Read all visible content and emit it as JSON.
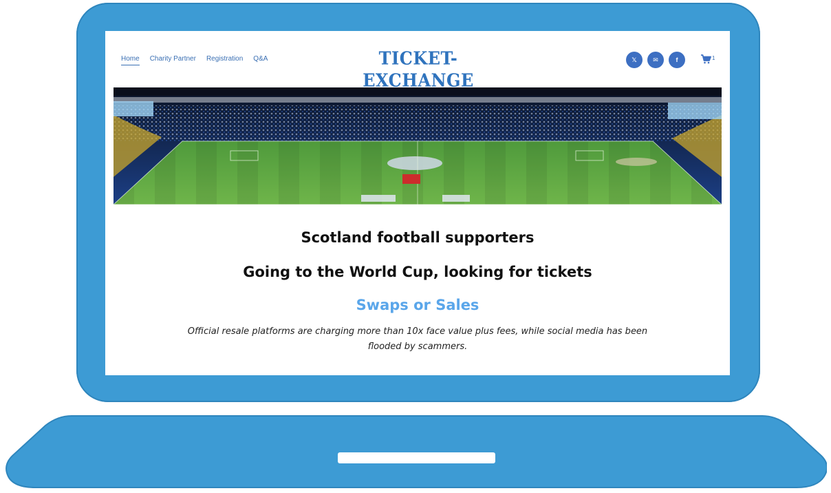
{
  "colors": {
    "frame": "#3d9bd4",
    "accent": "#2f73bd",
    "swaps": "#5aa6ea",
    "social": "#3d6fc2"
  },
  "nav": {
    "items": [
      {
        "label": "Home",
        "active": true
      },
      {
        "label": "Charity Partner",
        "active": false
      },
      {
        "label": "Registration",
        "active": false
      },
      {
        "label": "Q&A",
        "active": false
      }
    ]
  },
  "logo": {
    "text": "TICKET-EXCHANGE"
  },
  "social": {
    "items": [
      {
        "glyph": "𝕏",
        "icon": "x-twitter-icon"
      },
      {
        "glyph": "✉",
        "icon": "mail-icon"
      },
      {
        "glyph": "f",
        "icon": "facebook-icon"
      }
    ]
  },
  "cart": {
    "count": "1",
    "icon": "cart-icon"
  },
  "banner": {
    "icon": "stadium-banner-image"
  },
  "content": {
    "heading1": "Scotland football supporters",
    "heading2": "Going to the World Cup, looking for tickets",
    "heading3": "Swaps or Sales",
    "intro": "Official resale platforms are charging more than 10x face value plus fees, while social media has been flooded by scammers."
  }
}
